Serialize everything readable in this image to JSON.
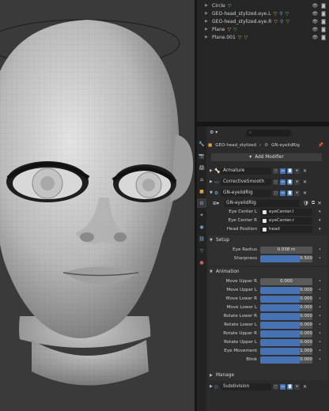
{
  "outliner": {
    "rows": [
      {
        "label": "Circle",
        "icon": "green-triangle"
      },
      {
        "label": "GEO-head_stylized.eye.L",
        "icon": "mesh-modifier-icons"
      },
      {
        "label": "GEO-head_stylized.eye.R",
        "icon": "mesh-modifier-icons"
      },
      {
        "label": "Plane",
        "icon": "mesh-modifier-icons"
      },
      {
        "label": "Plane.001",
        "icon": "mesh-modifier-icons"
      }
    ]
  },
  "properties": {
    "search_placeholder": "",
    "breadcrumb": {
      "object": "GEO-head_stylized",
      "modifier": "GN-eyelidRig"
    },
    "add_modifier": "Add Modifier",
    "modifiers": [
      {
        "name": "Armature",
        "expanded": false
      },
      {
        "name": "CorrectiveSmooth",
        "expanded": false
      },
      {
        "name": "GN-eyelidRig",
        "expanded": true
      }
    ],
    "node_group": "GN-eyelidRig",
    "inputs": [
      {
        "label": "Eye Center L",
        "value": "eyeCenter.l"
      },
      {
        "label": "Eye Center R",
        "value": "eyeCenter.r"
      },
      {
        "label": "Head Position",
        "value": "head"
      }
    ],
    "setup": {
      "title": "Setup",
      "fields": [
        {
          "label": "Eye Radius",
          "value": "0.038 m",
          "fill": 0
        },
        {
          "label": "Sharpness",
          "value": "0.500",
          "fill": 1
        }
      ]
    },
    "animation": {
      "title": "Animation",
      "fields": [
        {
          "label": "Move Upper R",
          "value": "0.000",
          "fill": 0
        },
        {
          "label": "Move Upper L",
          "value": "0.000",
          "fill": 1
        },
        {
          "label": "Move Lower R",
          "value": "0.000",
          "fill": 1
        },
        {
          "label": "Move Lower L",
          "value": "0.000",
          "fill": 1
        },
        {
          "label": "Rotate Lower R",
          "value": "0.000",
          "fill": 1
        },
        {
          "label": "Rotate Lower L",
          "value": "0.000",
          "fill": 1
        },
        {
          "label": "Rotate Upper R",
          "value": "0.000",
          "fill": 1
        },
        {
          "label": "Rotate Upper L",
          "value": "0.000",
          "fill": 1
        },
        {
          "label": "Eye Movement",
          "value": "1.000",
          "fill": 1
        },
        {
          "label": "Blink",
          "value": "0.000",
          "fill": 1
        }
      ]
    },
    "manage": {
      "title": "Manage"
    },
    "subdivision": {
      "name": "Subdivision"
    }
  },
  "colors": {
    "accent": "#4772b3",
    "panel": "#2b2b2b",
    "viewport": "#3a3a3a"
  }
}
